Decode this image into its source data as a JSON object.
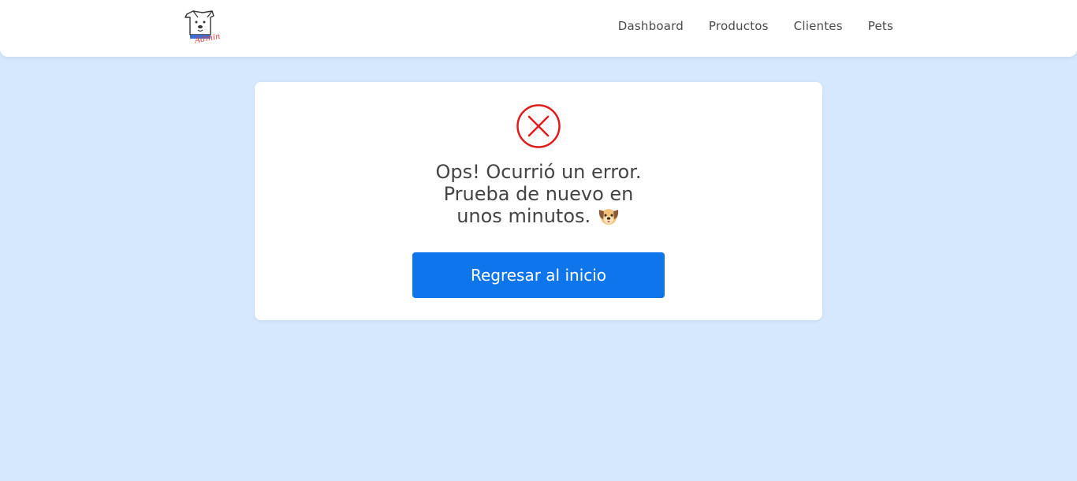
{
  "header": {
    "logo_icon": "dog-admin-logo-icon",
    "logo_text": "Admin",
    "nav_items": [
      {
        "label": "Dashboard"
      },
      {
        "label": "Productos"
      },
      {
        "label": "Clientes"
      },
      {
        "label": "Pets"
      }
    ]
  },
  "error_card": {
    "icon": "error-x-icon",
    "icon_color": "#e11b1b",
    "message_line1": "Ops! Ocurrió un error.",
    "message_line2": "Prueba de nuevo en",
    "message_line3": "unos minutos.",
    "emoji": "dog-face-icon",
    "button_label": "Regresar al inicio",
    "button_color": "#0f75ea"
  },
  "colors": {
    "background": "#d5e8fe",
    "header_bg": "#ffffff",
    "card_bg": "#ffffff"
  }
}
